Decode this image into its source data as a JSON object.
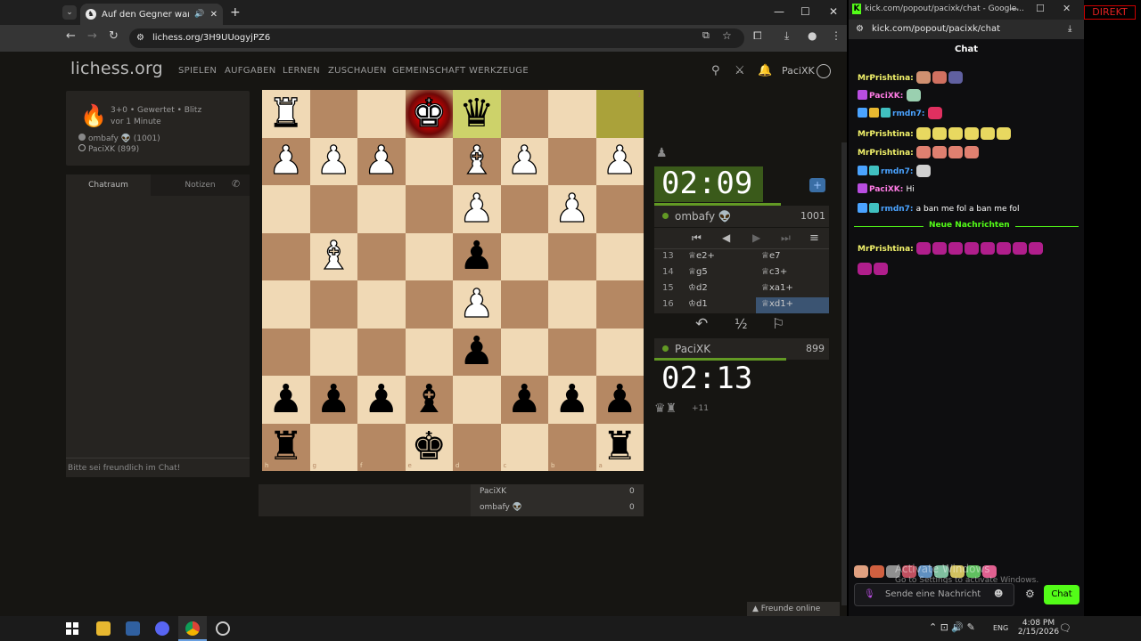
{
  "left_browser": {
    "tab_title": "Auf den Gegner warten - Sp",
    "url": "lichess.org/3H9UUogyjPZ6",
    "window_controls": [
      "—",
      "☐",
      "✕"
    ]
  },
  "lichess": {
    "logo_main": "lichess",
    "logo_suffix": ".org",
    "nav": [
      "SPIELEN",
      "AUFGABEN",
      "LERNEN",
      "ZUSCHAUEN",
      "GEMEINSCHAFT",
      "WERKZEUGE"
    ],
    "username": "PaciXK",
    "game_info": {
      "mode": "3+0 • Gewertet • Blitz",
      "time_ago": "vor 1 Minute",
      "player1": "ombafy 👽 (1001)",
      "player2": "PaciXK (899)"
    },
    "chat_tabs": [
      "Chatraum",
      "Notizen"
    ],
    "chat_placeholder": "Bitte sei freundlich im Chat!",
    "opponent": {
      "clock": "02:09",
      "name": "ombafy 👽",
      "rating": "1001"
    },
    "me": {
      "clock": "02:13",
      "name": "PaciXK",
      "rating": "899"
    },
    "material_advantage": "+11",
    "moves": [
      {
        "num": "13",
        "white": "♕e2+",
        "black": "♕e7"
      },
      {
        "num": "14",
        "white": "♕g5",
        "black": "♕c3+"
      },
      {
        "num": "15",
        "white": "♔d2",
        "black": "♕xa1+"
      },
      {
        "num": "16",
        "white": "♔d1",
        "black": "♕xd1+"
      }
    ],
    "score_rows": [
      {
        "name": "PaciXK",
        "score": "0"
      },
      {
        "name": "ombafy 👽",
        "score": "0"
      }
    ],
    "friends_online": "Freunde online",
    "board_files": [
      "h",
      "g",
      "f",
      "e",
      "d",
      "c",
      "b",
      "a"
    ],
    "board_ranks": [
      "1",
      "2",
      "3",
      "4",
      "5",
      "6",
      "7",
      "8"
    ]
  },
  "board": {
    "orientation": "black",
    "rows": [
      [
        "wR",
        "",
        "",
        "wK",
        "bQ",
        "",
        "",
        ""
      ],
      [
        "wP",
        "wP",
        "wP",
        "",
        "wB",
        "wP",
        "",
        "wP"
      ],
      [
        "",
        "",
        "",
        "",
        "wP",
        "",
        "wP",
        ""
      ],
      [
        "",
        "wB",
        "",
        "",
        "bP",
        "",
        "",
        ""
      ],
      [
        "",
        "",
        "",
        "",
        "wP",
        "",
        "",
        ""
      ],
      [
        "",
        "",
        "",
        "",
        "bP",
        "",
        "",
        ""
      ],
      [
        "bP",
        "bP",
        "bP",
        "bB",
        "",
        "bP",
        "bP",
        "bP"
      ],
      [
        "bR",
        "",
        "",
        "bK",
        "",
        "",
        "",
        "bR"
      ]
    ],
    "check_square": [
      0,
      3
    ],
    "last_move_squares": [
      [
        0,
        4
      ],
      [
        0,
        7
      ]
    ]
  },
  "kick": {
    "popup_title": "kick.com/popout/pacixk/chat - Google...",
    "url": "kick.com/popout/pacixk/chat",
    "chat_title": "Chat",
    "messages": [
      {
        "user": "MrPrishtina:",
        "color": "#f3f36b",
        "text": ""
      },
      {
        "user": "PaciXK:",
        "color": "#ff7ce5",
        "text": ""
      },
      {
        "user": "rmdn7:",
        "color": "#4aa3ff",
        "text": ""
      },
      {
        "user": "MrPrishtina:",
        "color": "#f3f36b",
        "text": ""
      },
      {
        "user": "MrPrishtina:",
        "color": "#f3f36b",
        "text": ""
      },
      {
        "user": "rmdn7:",
        "color": "#4aa3ff",
        "text": ""
      },
      {
        "user": "PaciXK:",
        "color": "#ff7ce5",
        "text": "Hi"
      },
      {
        "user": "rmdn7:",
        "color": "#4aa3ff",
        "text": "a ban me fol a ban me fol"
      }
    ],
    "new_messages": "Neue Nachrichten",
    "after_new": {
      "user": "MrPrishtina:",
      "color": "#f3f36b"
    },
    "send_placeholder": "Sende eine Nachricht",
    "chat_button": "Chat",
    "watermark_line1": "Activate Windows",
    "watermark_line2": "Go to Settings to activate Windows.",
    "direkt_label": "DIREKT"
  },
  "taskbar": {
    "lang": "ENG",
    "time": "4:08 PM",
    "date": "2/15/2026"
  },
  "colors": {
    "kick_green": "#53fc18",
    "lichess_bg": "#161512",
    "light_square": "#f0d9b5",
    "dark_square": "#b58863"
  }
}
